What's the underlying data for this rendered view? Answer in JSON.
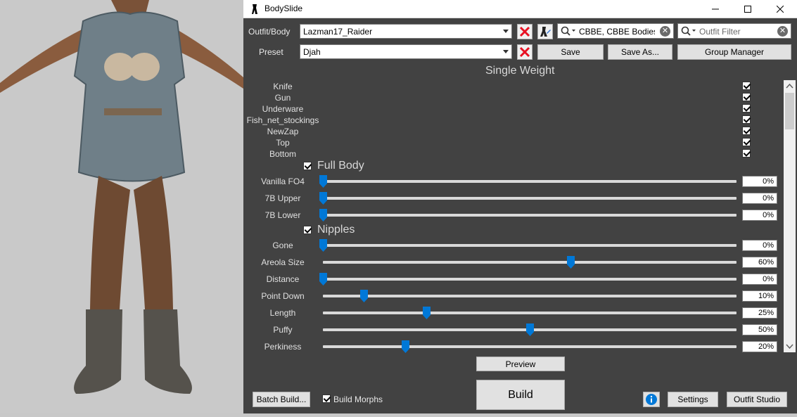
{
  "window": {
    "title": "BodySlide"
  },
  "outfit": {
    "label": "Outfit/Body",
    "value": "Lazman17_Raider"
  },
  "preset": {
    "label": "Preset",
    "value": "Djah"
  },
  "group_filter": {
    "value": "CBBE, CBBE Bodies, C"
  },
  "outfit_filter": {
    "placeholder": "Outfit Filter"
  },
  "buttons": {
    "save": "Save",
    "save_as": "Save As...",
    "group_manager": "Group Manager",
    "preview": "Preview",
    "build": "Build",
    "batch_build": "Batch Build...",
    "settings": "Settings",
    "outfit_studio": "Outfit Studio"
  },
  "build_morphs": {
    "label": "Build Morphs",
    "checked": true
  },
  "weight_mode": "Single Weight",
  "zap_options": [
    {
      "label": "Knife",
      "checked": true
    },
    {
      "label": "Gun",
      "checked": true
    },
    {
      "label": "Underware",
      "checked": true
    },
    {
      "label": "Fish_net_stockings",
      "checked": true
    },
    {
      "label": "NewZap",
      "checked": true
    },
    {
      "label": "Top",
      "checked": true
    },
    {
      "label": "Bottom",
      "checked": true
    }
  ],
  "groups": [
    {
      "title": "Full Body",
      "checked": true,
      "sliders": [
        {
          "label": "Vanilla FO4",
          "value": 0,
          "text": "0%"
        },
        {
          "label": "7B Upper",
          "value": 0,
          "text": "0%"
        },
        {
          "label": "7B Lower",
          "value": 0,
          "text": "0%"
        }
      ]
    },
    {
      "title": "Nipples",
      "checked": true,
      "sliders": [
        {
          "label": "Gone",
          "value": 0,
          "text": "0%"
        },
        {
          "label": "Areola Size",
          "value": 60,
          "text": "60%"
        },
        {
          "label": "Distance",
          "value": 0,
          "text": "0%"
        },
        {
          "label": "Point Down",
          "value": 10,
          "text": "10%"
        },
        {
          "label": "Length",
          "value": 25,
          "text": "25%"
        },
        {
          "label": "Puffy",
          "value": 50,
          "text": "50%"
        },
        {
          "label": "Perkiness",
          "value": 20,
          "text": "20%"
        }
      ]
    }
  ],
  "colors": {
    "panel": "#424242",
    "accent": "#0078d7",
    "close_red": "#e81123"
  }
}
